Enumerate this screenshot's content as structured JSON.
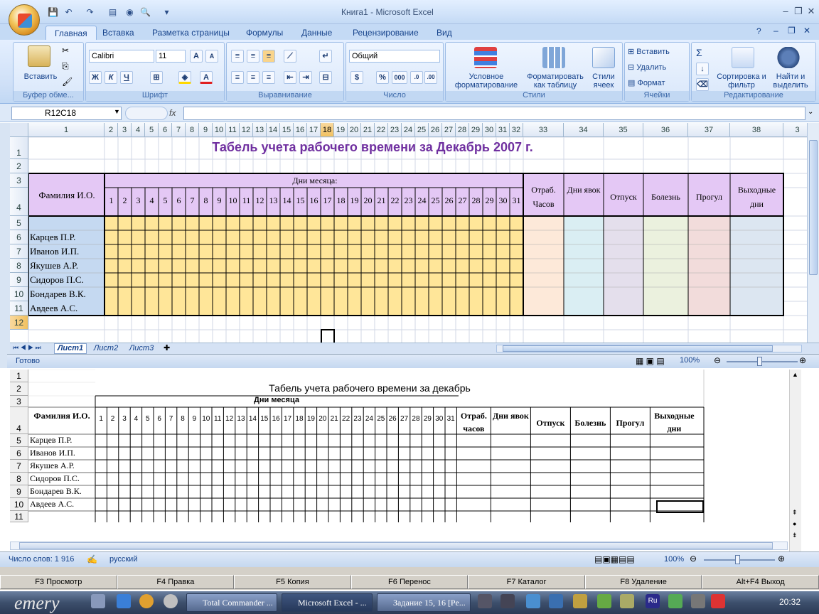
{
  "window": {
    "title": "Книга1 - Microsoft Excel"
  },
  "ribbon": {
    "tabs": [
      "Главная",
      "Вставка",
      "Разметка страницы",
      "Формулы",
      "Данные",
      "Рецензирование",
      "Вид"
    ],
    "clipboard": {
      "paste": "Вставить",
      "label": "Буфер обме..."
    },
    "font": {
      "name": "Calibri",
      "size": "11",
      "label": "Шрифт",
      "bold": "Ж",
      "italic": "К",
      "underline": "Ч"
    },
    "alignment": {
      "label": "Выравнивание"
    },
    "number": {
      "format": "Общий",
      "label": "Число",
      "percent": "%",
      "thousands": "000"
    },
    "styles": {
      "conditional": "Условное форматирование",
      "as_table": "Форматировать как таблицу",
      "cell_styles": "Стили ячеек",
      "label": "Стили"
    },
    "cells": {
      "insert": "Вставить",
      "delete": "Удалить",
      "format": "Формат",
      "label": "Ячейки"
    },
    "editing": {
      "sigma": "Σ",
      "sort": "Сортировка и фильтр",
      "find": "Найти и выделить",
      "label": "Редактирование"
    }
  },
  "formula_bar": {
    "name_box": "R12C18",
    "fx": "fx",
    "value": ""
  },
  "sheet1": {
    "col_headers": [
      "1",
      "2",
      "3",
      "4",
      "5",
      "6",
      "7",
      "8",
      "9",
      "10",
      "11",
      "12",
      "13",
      "14",
      "15",
      "16",
      "17",
      "18",
      "19",
      "20",
      "21",
      "22",
      "23",
      "24",
      "25",
      "26",
      "27",
      "28",
      "29",
      "30",
      "31",
      "32",
      "33",
      "34",
      "35",
      "36",
      "37",
      "38",
      "3"
    ],
    "selected_col": "18",
    "row_numbers": [
      "1",
      "2",
      "3",
      "4",
      "5",
      "6",
      "7",
      "8",
      "9",
      "10",
      "11",
      "12"
    ],
    "title": "Табель учета рабочего времени за Декабрь 2007 г.",
    "fio_header": "Фамилия И.О.",
    "days_header": "Дни месяца:",
    "days": [
      "1",
      "2",
      "3",
      "4",
      "5",
      "6",
      "7",
      "8",
      "9",
      "10",
      "11",
      "12",
      "13",
      "14",
      "15",
      "16",
      "17",
      "18",
      "19",
      "20",
      "21",
      "22",
      "23",
      "24",
      "25",
      "26",
      "27",
      "28",
      "29",
      "30",
      "31"
    ],
    "extra_headers": [
      "Отраб. Часов",
      "Дни явок",
      "Отпуск",
      "Болезнь",
      "Прогул",
      "Выходные дни"
    ],
    "names": [
      "Карцев П.Р.",
      "Иванов И.П.",
      "Якушев А.Р.",
      "Сидоров П.С.",
      "Бондарев В.К.",
      "Авдеев А.С."
    ],
    "sheet_tabs": [
      "Лист1",
      "Лист2",
      "Лист3"
    ],
    "status": "Готово",
    "zoom": "100%"
  },
  "sheet2": {
    "row_numbers": [
      "1",
      "2",
      "3",
      "4",
      "5",
      "6",
      "7",
      "8",
      "9",
      "10",
      "11"
    ],
    "title": "Табель учета рабочего времени за декабрь",
    "days_header": "Дни месяца",
    "fio_header": "Фамилия И.О.",
    "extra_headers": [
      "Отраб. часов",
      "Дни явок",
      "Отпуск",
      "Болезнь",
      "Прогул",
      "Выходные дни"
    ],
    "names": [
      "Карцев П.Р.",
      "Иванов И.П.",
      "Якушев А.Р.",
      "Сидоров П.С.",
      "Бондарев В.К.",
      "Авдеев А.С."
    ]
  },
  "word_status": {
    "words": "Число слов: 1 916",
    "lang": "русский",
    "zoom": "100%"
  },
  "fkeys": [
    "F3 Просмотр",
    "F4 Правка",
    "F5 Копия",
    "F6 Перенос",
    "F7 Каталог",
    "F8 Удаление",
    "Alt+F4 Выход"
  ],
  "taskbar": {
    "tasks": [
      "Total Commander ...",
      "Microsoft Excel - ...",
      "Задание 15, 16 [Ре..."
    ],
    "clock": "20:32",
    "brand": "emery"
  },
  "colors": {
    "yellow": "#ffe699",
    "pink": "#fde9d9",
    "blue": "#daeef3",
    "lavender": "#e4dfec",
    "green": "#ebf1de",
    "rose": "#f2dcdb",
    "lightblue": "#dce6f1",
    "header_purple": "#e4c8f5",
    "name_blue": "#c5d9f1",
    "title_purple": "#7030a0"
  }
}
